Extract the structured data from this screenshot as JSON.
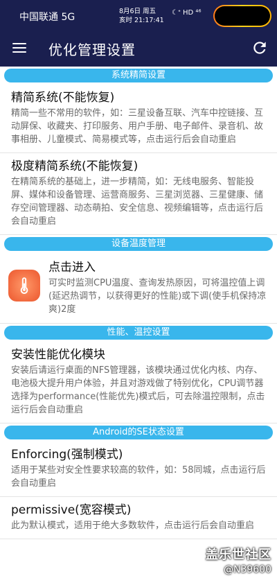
{
  "status_bar": {
    "carrier": "中国联通 5G",
    "date_line": "8月6日 周五",
    "time_line": "亥时 21:17:41",
    "icons": "☾ᐩ HD ⁴⁶"
  },
  "app_bar": {
    "title": "优化管理设置"
  },
  "sections": {
    "slim": {
      "header": "系统精简设置",
      "items": [
        {
          "title": "精简系统(不能恢复)",
          "desc": "精简一些不常用的软件，如：三星设备互联、汽车中控链接、互动屏保、收藏夹、打印服务、用户手册、电子邮件、录音机、故事相册、儿童模式、简易模式等，点击运行后会自动重启"
        },
        {
          "title": "极度精简系统(不能恢复)",
          "desc": "在精简系统的基础上，进一步精简，如：无线电服务、智能投屏、媒体和设备管理、运营商服务、三星浏览器、三星健康、储存空间管理器、动态萌拍、安全信息、视频编辑等，点击运行后会自动重启"
        }
      ]
    },
    "temp": {
      "header": "设备温度管理",
      "item": {
        "title": "点击进入",
        "desc": "可实时监测CPU温度、查询发热原因，可将温控值上调(延迟热调节，以获得更好的性能)或下调(使手机保持凉爽)2度"
      }
    },
    "perf": {
      "header": "性能、温控设置",
      "item": {
        "title": "安装性能优化模块",
        "desc": "安装后请运行桌面的NFS管理器，该模块通过优化内核、内存、电池极大提升用户体验，并且对游戏做了特别优化，CPU调节器选择为performance(性能优先)模式后，可去除温控限制，点击运行后会自动重启"
      }
    },
    "selinux": {
      "header": "Android的SE状态设置",
      "items": [
        {
          "title": "Enforcing(强制模式)",
          "desc": "适用于某些对安全性要求较高的软件，如：58同城，点击运行后会自动重启"
        },
        {
          "title": "permissive(宽容模式)",
          "desc": "此为默认模式，适用于绝大多数软件，点击运行后会自动重启"
        }
      ]
    }
  },
  "watermark": {
    "title": "盖乐世社区",
    "user": "@N39600"
  },
  "colors": {
    "header_bg": "#1a1f4f",
    "section_bar": "#39b6ec",
    "temp_icon": "#f26a3f"
  }
}
